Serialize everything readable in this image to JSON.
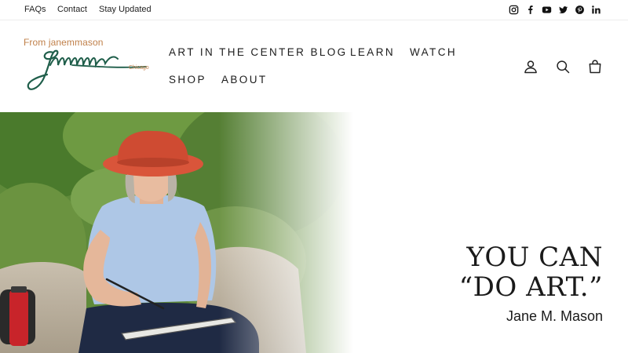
{
  "topbar": {
    "links": [
      "FAQs",
      "Contact",
      "Stay Updated"
    ],
    "social_icons": [
      "instagram-icon",
      "facebook-icon",
      "youtube-icon",
      "twitter-icon",
      "pinterest-icon",
      "linkedin-icon"
    ]
  },
  "logo": {
    "from_text": "From janemmason",
    "city_text": "Chicago",
    "signature_color": "#1f5e4a",
    "accent_color": "#c0804a"
  },
  "nav": {
    "items": [
      "ART IN THE CENTER BLOG",
      "LEARN",
      "WATCH",
      "SHOP",
      "ABOUT"
    ]
  },
  "header_icons": [
    "account-icon",
    "search-icon",
    "cart-icon"
  ],
  "hero": {
    "heading_line1": "YOU CAN",
    "heading_line2": "“DO ART.”",
    "subheading": "Jane M. Mason",
    "hat_color": "#d9553a",
    "shirt_color": "#aec7e6"
  }
}
